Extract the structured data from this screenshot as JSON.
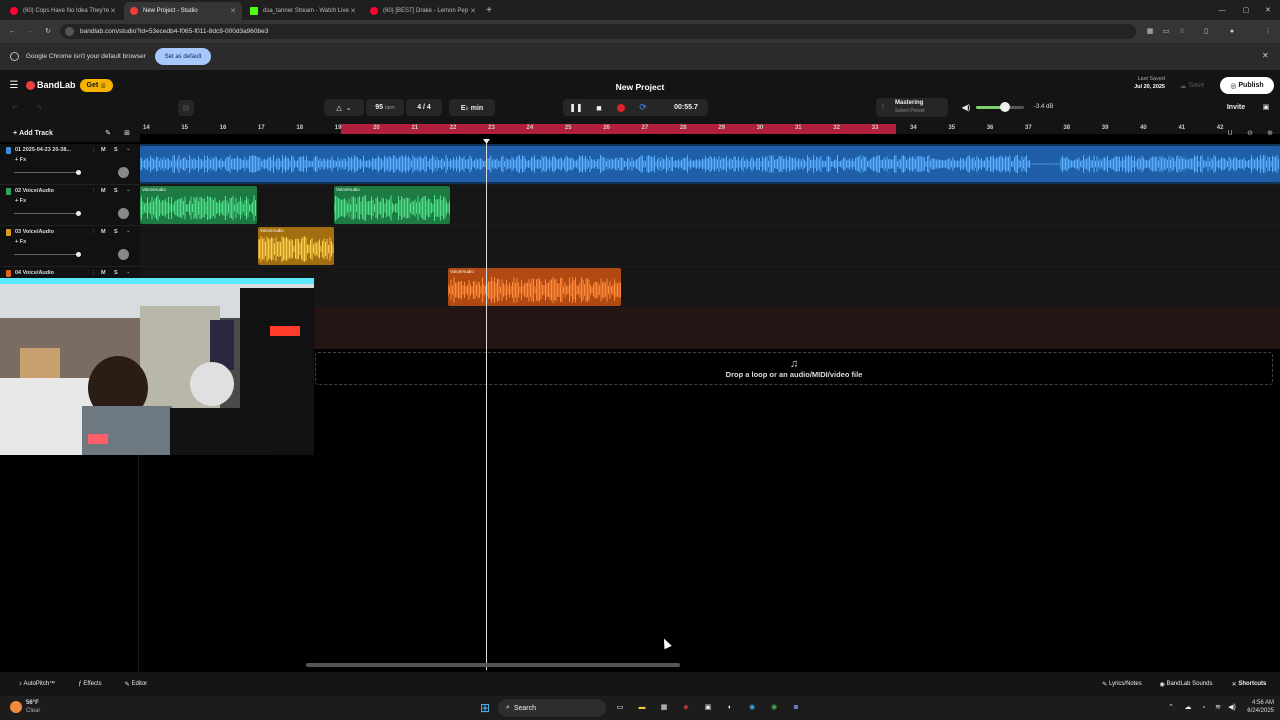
{
  "browser": {
    "tabs": [
      {
        "title": "(60) Cops Have No Idea They're",
        "icon": "youtube-icon",
        "color": "#ff0033",
        "active": false
      },
      {
        "title": "New Project - Studio",
        "icon": "bandlab-icon",
        "color": "#f13c3c",
        "active": true
      },
      {
        "title": "dsa_tanner Stream - Watch Live",
        "icon": "kick-icon",
        "color": "#53fc18",
        "active": false
      },
      {
        "title": "(60) [BEST] Drake - Lemon Pep",
        "icon": "youtube-icon",
        "color": "#ff0033",
        "active": false
      }
    ],
    "url": "bandlab.com/studio?id=53ecedb4-f065-f011-8dc9-000d3a960be3",
    "infobar_text": "Google Chrome isn't your default browser",
    "infobar_button": "Set as default"
  },
  "studio": {
    "logo": "BandLab",
    "get_label": "Get",
    "project_title": "New Project",
    "last_saved_label": "Last Saved",
    "last_saved_date": "Jul 20, 2025",
    "save_label": "Save",
    "publish_label": "Publish",
    "invite_label": "Invite",
    "bpm": "95",
    "bpm_unit": "bpm",
    "time_signature": "4 / 4",
    "key": "E♭ min",
    "time": "00:55.7",
    "mastering_label": "Mastering",
    "mastering_sub": "Select Preset",
    "volume_db": "-3.4 dB",
    "volume_level": 0.6,
    "add_track_label": "Add Track",
    "drop_text": "Drop a loop or an audio/MIDI/video file"
  },
  "ruler": [
    "14",
    "15",
    "16",
    "17",
    "18",
    "19",
    "20",
    "21",
    "22",
    "23",
    "24",
    "25",
    "26",
    "27",
    "28",
    "29",
    "30",
    "31",
    "32",
    "33",
    "34",
    "35",
    "36",
    "37",
    "38",
    "39",
    "40",
    "41",
    "42"
  ],
  "tracks": [
    {
      "name": "01  2025-04-23 20-38...",
      "fx": "+ Fx",
      "color": "#3b8fe0",
      "m": "M",
      "s": "S"
    },
    {
      "name": "02  Voice/Audio",
      "fx": "+ Fx",
      "color": "#2aa85a",
      "m": "M",
      "s": "S"
    },
    {
      "name": "03  Voice/Audio",
      "fx": "+ Fx",
      "color": "#d99a1e",
      "m": "M",
      "s": "S"
    },
    {
      "name": "04  Voice/Audio",
      "fx": "+ Fx",
      "color": "#e0621c",
      "m": "M",
      "s": "S"
    }
  ],
  "clip_label": "Voice/Audio",
  "bottom": {
    "autopitch": "AutoPitch™",
    "effects": "Effects",
    "editor": "Editor",
    "lyrics": "Lyrics/Notes",
    "sounds": "BandLab Sounds",
    "shortcuts": "Shortcuts"
  },
  "taskbar": {
    "weather_temp": "56°F",
    "weather_desc": "Clear",
    "search": "Search",
    "time": "4:56 AM",
    "date": "6/24/2025"
  }
}
